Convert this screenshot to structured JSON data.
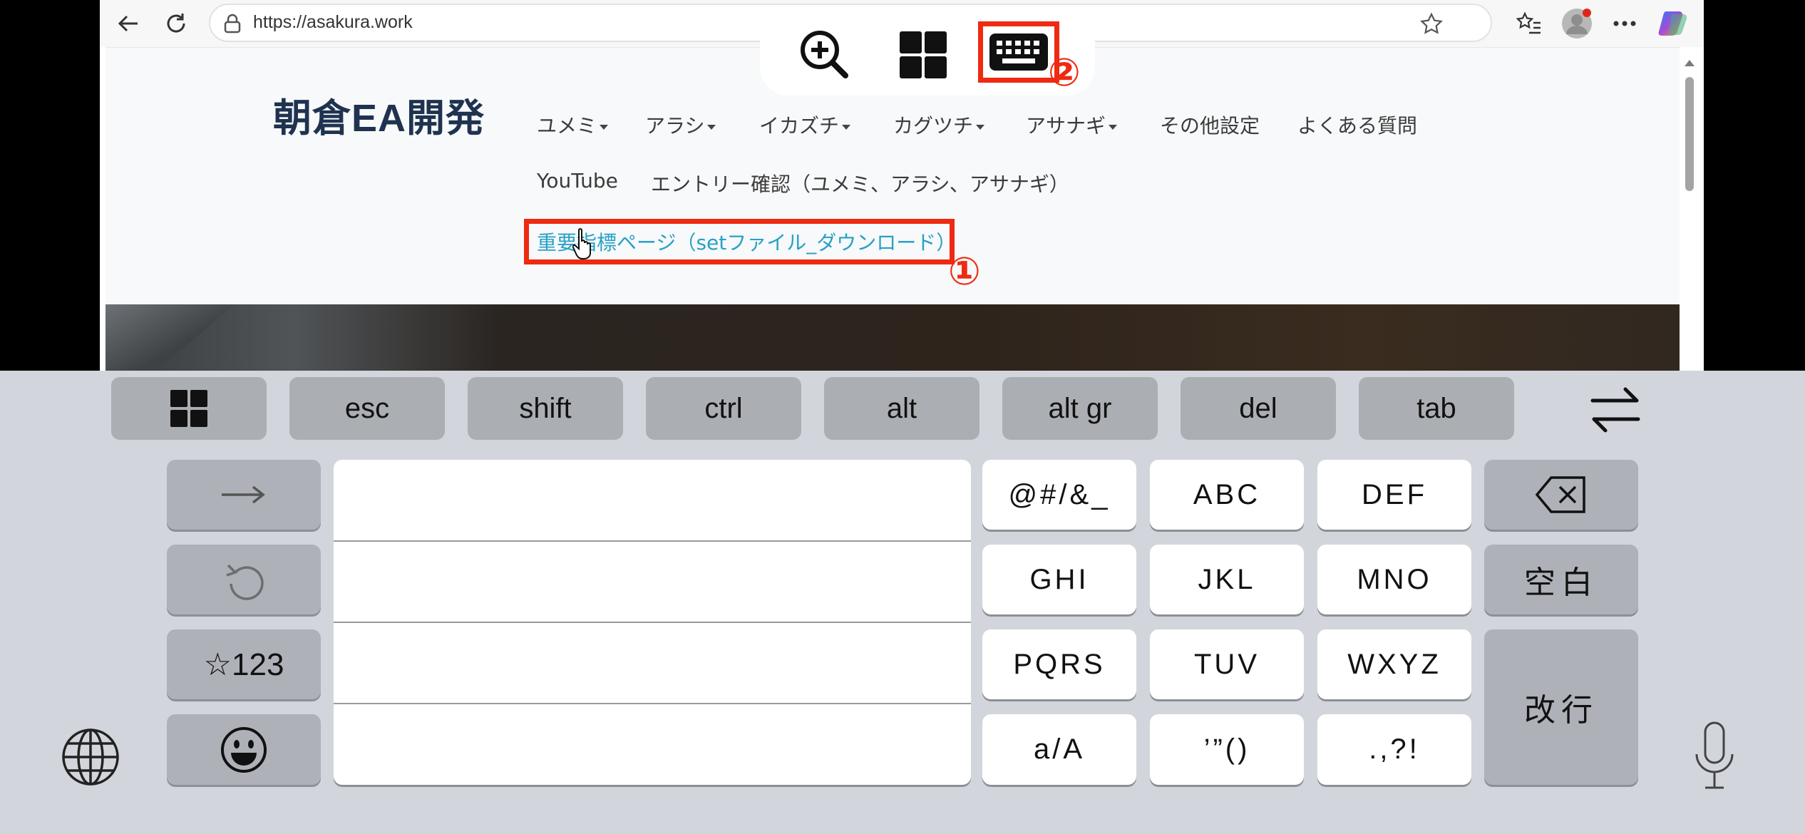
{
  "browser": {
    "url": "https://asakura.work",
    "site_logo": "朝倉EA開発",
    "nav_row1": [
      "ユメミ",
      "アラシ",
      "イカズチ",
      "カグツチ",
      "アサナギ",
      "その他設定",
      "よくある質問"
    ],
    "nav_row2": [
      "YouTube",
      "エントリー確認（ユメミ、アラシ、アサナギ）"
    ],
    "nav_important": "重要指標ページ（setファイル_ダウンロード）",
    "annotation_1": "①",
    "annotation_2": "②"
  },
  "keyboard": {
    "function_keys": [
      "esc",
      "shift",
      "ctrl",
      "alt",
      "alt gr",
      "del",
      "tab"
    ],
    "left_column": {
      "symbols_label": "☆123"
    },
    "grid": [
      [
        "@#/&_",
        "ABC",
        "DEF"
      ],
      [
        "GHI",
        "JKL",
        "MNO"
      ],
      [
        "PQRS",
        "TUV",
        "WXYZ"
      ],
      [
        "a/A",
        "’”()",
        ".,?!"
      ]
    ],
    "space_label": "空白",
    "enter_label": "改行"
  },
  "colors": {
    "annotation": "#ee2a11",
    "link": "#27a1c7",
    "logo": "#1f3350",
    "keyboard_bg": "#d2d6dc"
  }
}
